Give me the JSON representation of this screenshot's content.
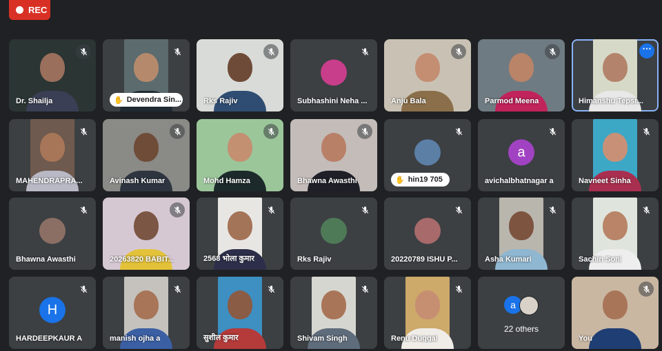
{
  "recording": {
    "label": "REC"
  },
  "tiles": [
    {
      "name": "Dr. Shailja",
      "kind": "video",
      "bg": "#2b3533",
      "skin": "#9a6f5c",
      "shirt": "#3a3f55",
      "full": true
    },
    {
      "name": "Devendra Sin...",
      "kind": "video",
      "bg": "#5b6b6e",
      "skin": "#b58a6c",
      "shirt": "#1f2a33",
      "hand": true
    },
    {
      "name": "Rks Rajiv",
      "kind": "video",
      "bg": "#d9dbd8",
      "skin": "#6e4b38",
      "shirt": "#2f4d73",
      "full": true
    },
    {
      "name": "Subhashini Neha ...",
      "kind": "avatar",
      "avatarColor": "#c83e8b"
    },
    {
      "name": "Anju Bala",
      "kind": "video",
      "bg": "#c9c2b4",
      "skin": "#c48e73",
      "shirt": "#8b6f4a",
      "full": true
    },
    {
      "name": "Parmod Meena",
      "kind": "video",
      "bg": "#6f7b82",
      "skin": "#b98468",
      "shirt": "#c1235b",
      "full": true
    },
    {
      "name": "Himanshu Tepsr...",
      "kind": "video",
      "bg": "#d7d9c8",
      "skin": "#b3846b",
      "shirt": "#e8e8e8",
      "active": true,
      "more": true
    },
    {
      "name": "MAHENDRAPRA...",
      "kind": "video",
      "bg": "#6e5a4e",
      "skin": "#a77658",
      "shirt": "#b9b9c6"
    },
    {
      "name": "Avinash Kumar",
      "kind": "video",
      "bg": "#8a8a86",
      "skin": "#6f4c38",
      "shirt": "#2e3540",
      "full": true
    },
    {
      "name": "Mohd Hamza",
      "kind": "video",
      "bg": "#9bc69a",
      "skin": "#c39072",
      "shirt": "#1d2a2b",
      "full": true
    },
    {
      "name": "Bhawna Awasthi",
      "kind": "video",
      "bg": "#c3bcb9",
      "skin": "#b98068",
      "shirt": "#1f1f28",
      "full": true
    },
    {
      "name": "hin19 705",
      "kind": "avatar",
      "avatarColor": "#5c7fa6",
      "pill": true
    },
    {
      "name": "avichalbhatnagar a",
      "kind": "letter",
      "letter": "a",
      "avatarColor": "#a142c2"
    },
    {
      "name": "Navneet Sinha",
      "kind": "video",
      "bg": "#3da7c6",
      "skin": "#c89177",
      "shirt": "#a92f50"
    },
    {
      "name": "Bhawna Awasthi",
      "kind": "avatar",
      "avatarColor": "#8c6f64"
    },
    {
      "name": "20263820 BABIT...",
      "kind": "video",
      "bg": "#d6c8d3",
      "skin": "#7b5644",
      "shirt": "#e3c23a",
      "full": true
    },
    {
      "name": "2568 भोला कुमार",
      "kind": "video",
      "bg": "#e7e6e3",
      "skin": "#a47458",
      "shirt": "#2d2f4a"
    },
    {
      "name": "Rks Rajiv",
      "kind": "avatar",
      "avatarColor": "#4f7a57"
    },
    {
      "name": "20220789 ISHU P...",
      "kind": "avatar",
      "avatarColor": "#a86a6a"
    },
    {
      "name": "Asha Kumari",
      "kind": "video",
      "bg": "#b9b6ae",
      "skin": "#7d5440",
      "shirt": "#8fb7d1"
    },
    {
      "name": "Sachin Soni",
      "kind": "video",
      "bg": "#dfe5dc",
      "skin": "#b98468",
      "shirt": "#eeeeee"
    },
    {
      "name": "HARDEEPKAUR A",
      "kind": "letter",
      "letter": "H",
      "avatarColor": "#1a73e8"
    },
    {
      "name": "manish ojha a",
      "kind": "video",
      "bg": "#c5c2bd",
      "skin": "#a87558",
      "shirt": "#3b5fa3"
    },
    {
      "name": "सुशील कुमार",
      "kind": "video",
      "bg": "#3e8fc2",
      "skin": "#8a5c46",
      "shirt": "#b53a3a"
    },
    {
      "name": "Shivam Singh",
      "kind": "video",
      "bg": "#d6d6d0",
      "skin": "#a97558",
      "shirt": "#5f6c7c"
    },
    {
      "name": "Renu Duggal",
      "kind": "video",
      "bg": "#cda96a",
      "skin": "#c78f72",
      "shirt": "#f0ede9"
    },
    {
      "name": "",
      "kind": "others",
      "othersLabel": "22 others",
      "letter": "a"
    },
    {
      "name": "You",
      "kind": "video",
      "bg": "#c9b7a2",
      "skin": "#a97558",
      "shirt": "#1e3e74",
      "full": true,
      "self": true
    }
  ]
}
